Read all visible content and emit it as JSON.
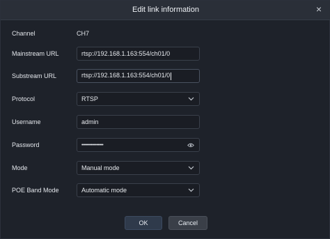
{
  "dialog": {
    "title": "Edit link information",
    "close_glyph": "×"
  },
  "fields": {
    "channel": {
      "label": "Channel",
      "value": "CH7"
    },
    "mainstream": {
      "label": "Mainstream URL",
      "value": "rtsp://192.168.1.163:554/ch01/0"
    },
    "substream": {
      "label": "Substream URL",
      "value": "rtsp://192.168.1.163:554/ch01/0"
    },
    "protocol": {
      "label": "Protocol",
      "value": "RTSP"
    },
    "username": {
      "label": "Username",
      "value": "admin"
    },
    "password": {
      "label": "Password",
      "value": "••••••••••••••••"
    },
    "mode": {
      "label": "Mode",
      "value": "Manual mode"
    },
    "poe": {
      "label": "POE Band Mode",
      "value": "Automatic mode"
    }
  },
  "buttons": {
    "ok": "OK",
    "cancel": "Cancel"
  },
  "icons": {
    "dropdown": "chevron-down-icon",
    "password_toggle": "eye-icon",
    "close": "close-icon"
  }
}
